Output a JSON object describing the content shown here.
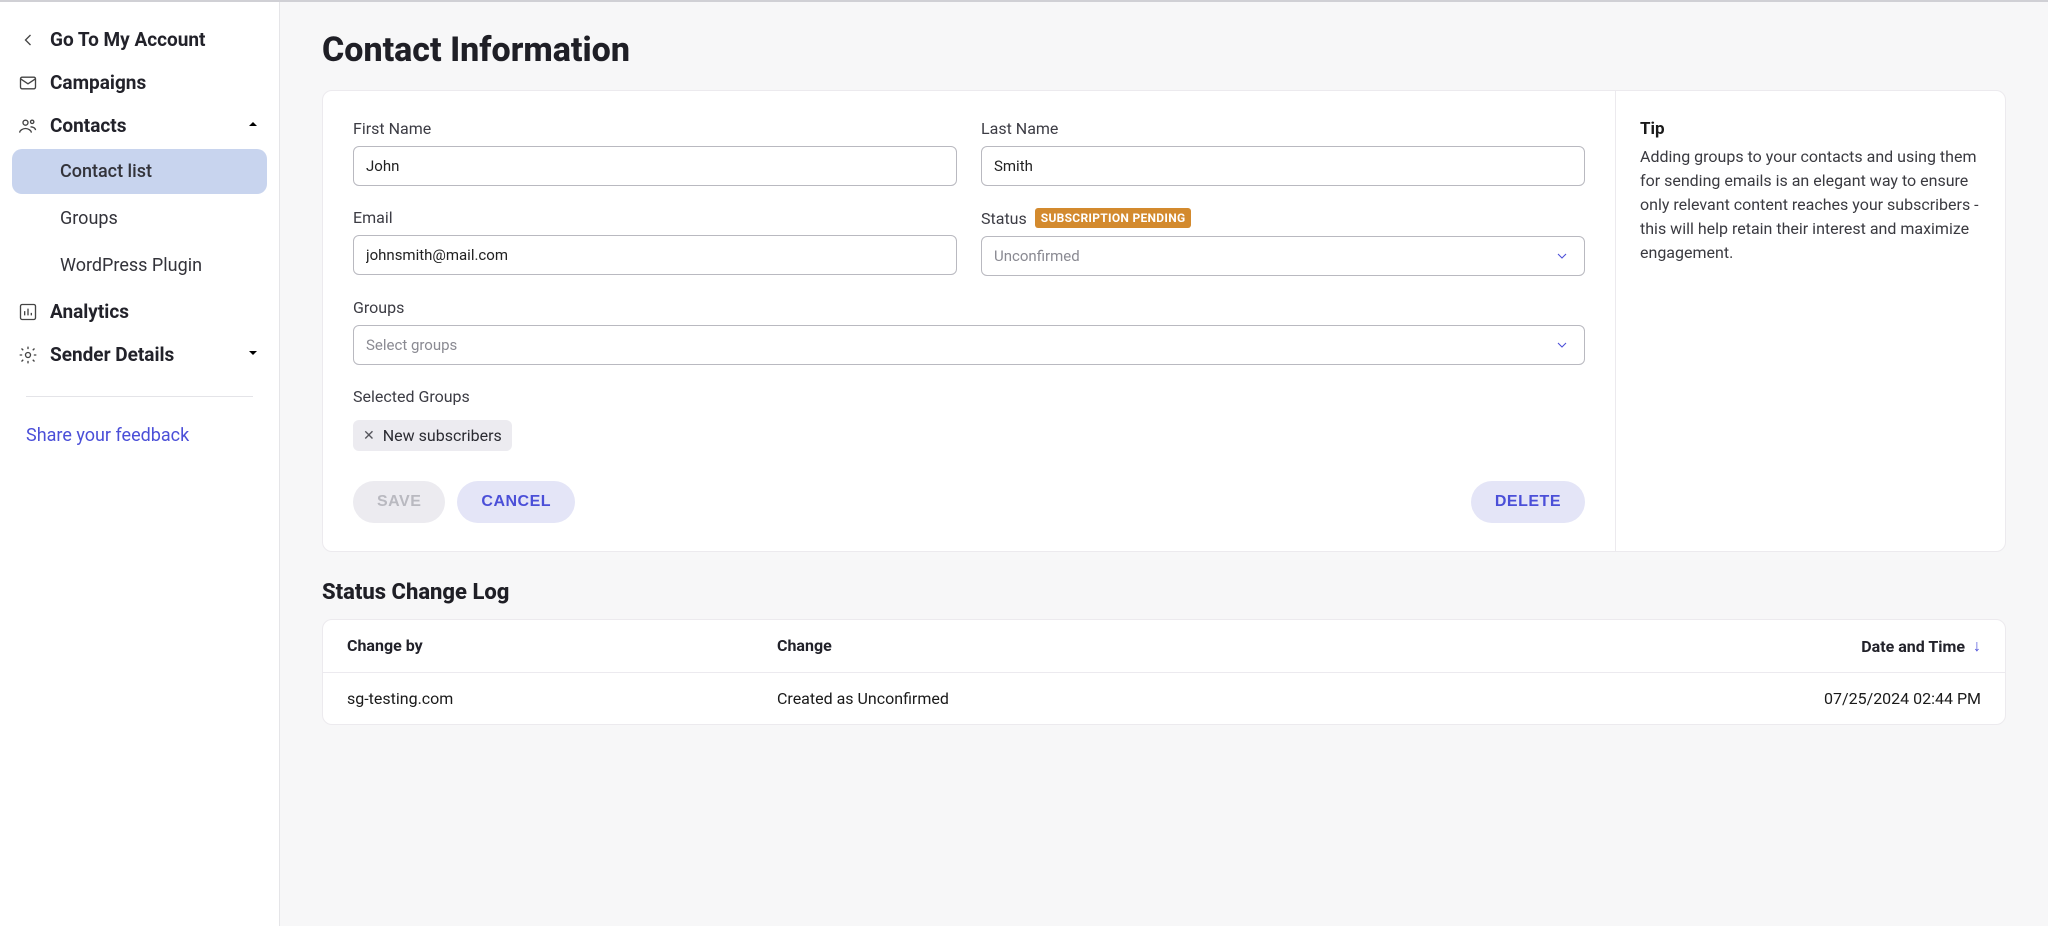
{
  "sidebar": {
    "back_label": "Go To My Account",
    "items": [
      {
        "id": "campaigns",
        "label": "Campaigns",
        "icon": "mail",
        "expandable": false
      },
      {
        "id": "contacts",
        "label": "Contacts",
        "icon": "people",
        "expandable": true,
        "expanded": true,
        "children": [
          {
            "id": "contact-list",
            "label": "Contact list",
            "active": true
          },
          {
            "id": "groups",
            "label": "Groups",
            "active": false
          },
          {
            "id": "wp-plugin",
            "label": "WordPress Plugin",
            "active": false
          }
        ]
      },
      {
        "id": "analytics",
        "label": "Analytics",
        "icon": "chart",
        "expandable": false
      },
      {
        "id": "sender-details",
        "label": "Sender Details",
        "icon": "gear",
        "expandable": true,
        "expanded": false
      }
    ],
    "feedback_label": "Share your feedback"
  },
  "page": {
    "title": "Contact Information",
    "first_name_label": "First Name",
    "first_name_value": "John",
    "last_name_label": "Last Name",
    "last_name_value": "Smith",
    "email_label": "Email",
    "email_value": "johnsmith@mail.com",
    "status_label": "Status",
    "status_badge": "SUBSCRIPTION PENDING",
    "status_value": "Unconfirmed",
    "groups_label": "Groups",
    "groups_placeholder": "Select groups",
    "selected_groups_label": "Selected Groups",
    "selected_groups": [
      "New subscribers"
    ],
    "save_label": "SAVE",
    "cancel_label": "CANCEL",
    "delete_label": "DELETE"
  },
  "tip": {
    "title": "Tip",
    "body": "Adding groups to your contacts and using them for sending emails is an elegant way to ensure only relevant content reaches your subscribers - this will help retain their interest and maximize engagement."
  },
  "log": {
    "title": "Status Change Log",
    "columns": {
      "by": "Change by",
      "change": "Change",
      "dt": "Date and Time"
    },
    "rows": [
      {
        "by": "sg-testing.com",
        "change": "Created as Unconfirmed",
        "dt": "07/25/2024 02:44 PM"
      }
    ]
  }
}
